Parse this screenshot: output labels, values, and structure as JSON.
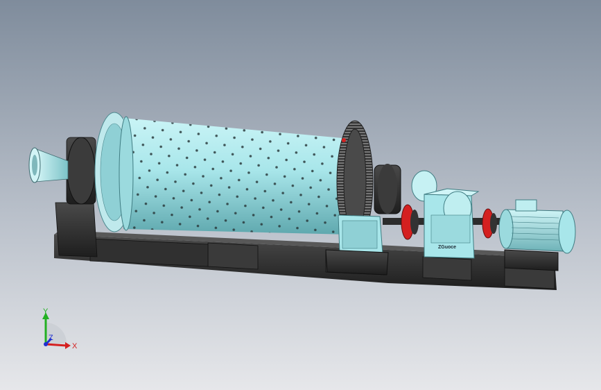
{
  "scene": {
    "subject": "ball-mill-assembly"
  },
  "gearbox": {
    "nameplate_text": "ZGuoce"
  },
  "triad": {
    "axis_x": "X",
    "axis_y": "Y",
    "axis_z": "Z",
    "colors": {
      "x": "#d42020",
      "y": "#22b022",
      "z": "#2030d0"
    }
  },
  "colors": {
    "background_top": "#7f8c9c",
    "background_bottom": "#e6e7ea",
    "machine_body": "#a8e6ea",
    "base_frame": "#2b2b2b",
    "coupling": "#d42020"
  }
}
